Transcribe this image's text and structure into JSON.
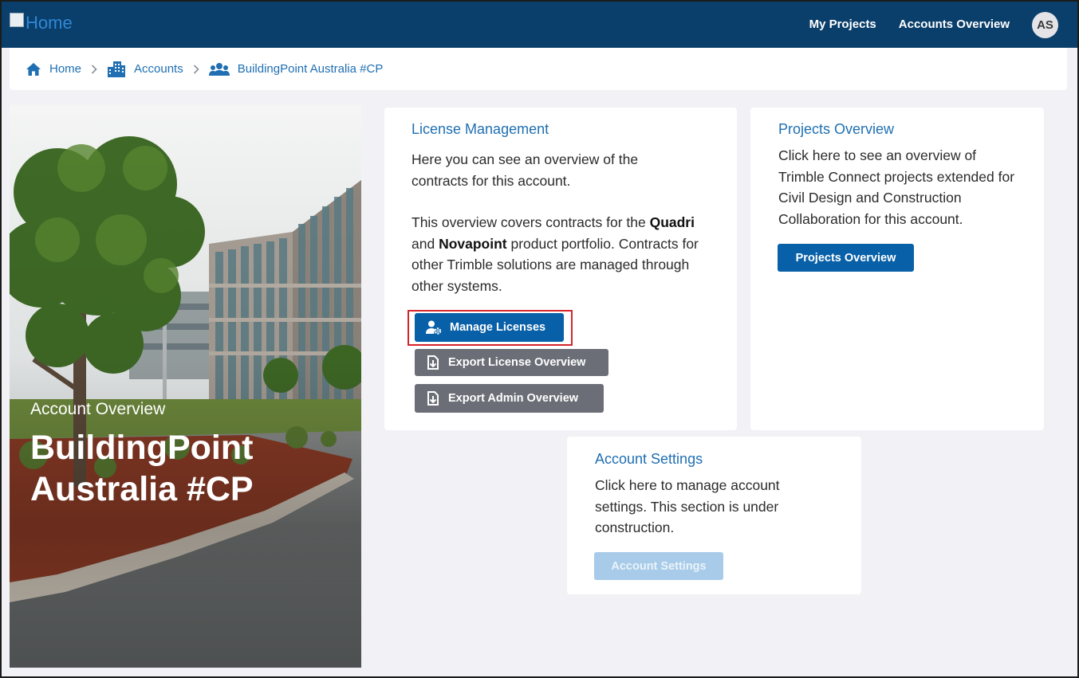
{
  "topbar": {
    "home_link_text": "Home",
    "nav": [
      "My Projects",
      "Accounts Overview"
    ],
    "avatar_initials": "AS"
  },
  "breadcrumb": {
    "items": [
      "Home",
      "Accounts",
      "BuildingPoint Australia #CP"
    ]
  },
  "hero": {
    "subtitle": "Account Overview",
    "title": "BuildingPoint Australia #CP"
  },
  "license_card": {
    "title": "License Management",
    "para1": "Here you can see an overview of the contracts for this account.",
    "para2_prefix": "This overview covers contracts for the ",
    "para2_bold1": "Quadri",
    "para2_mid": " and ",
    "para2_bold2": "Novapoint",
    "para2_suffix": " product portfolio. Contracts for other Trimble solutions are managed through other systems.",
    "buttons": {
      "manage": "Manage Licenses",
      "export_license": "Export License Overview",
      "export_admin": "Export Admin Overview"
    }
  },
  "projects_card": {
    "title": "Projects Overview",
    "text": "Click here to see an overview of Trimble Connect projects extended for Civil Design and Construction Collaboration for this account.",
    "button": "Projects Overview"
  },
  "settings_card": {
    "title": "Account Settings",
    "text": "Click here to manage account settings. This section is under construction.",
    "button": "Account Settings"
  },
  "colors": {
    "nav_bg": "#0b3f6b",
    "primary": "#0860a8",
    "link": "#1f6fb2",
    "highlight": "#d4252b"
  }
}
